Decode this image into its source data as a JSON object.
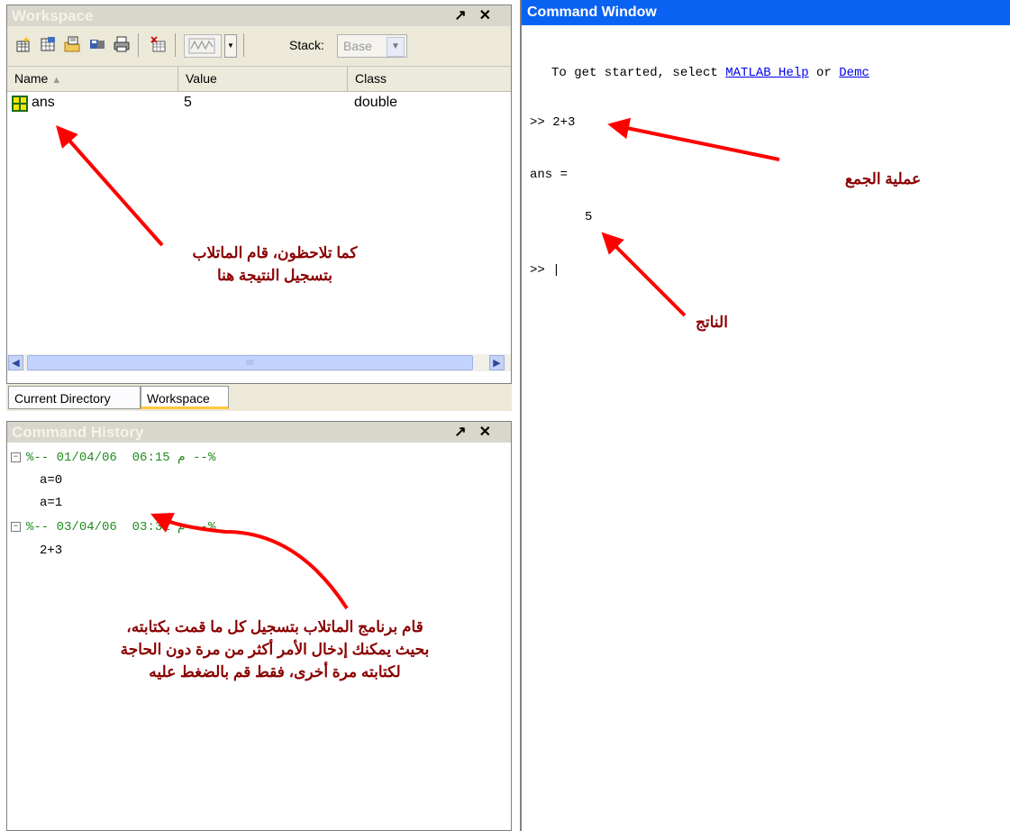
{
  "workspace": {
    "title": "Workspace",
    "undock_label": "↗",
    "close_label": "✕",
    "toolbar": {
      "stack_label": "Stack:",
      "stack_value": "Base",
      "icons": [
        "new-variable-icon",
        "open-variable-icon",
        "import-data-icon",
        "save-icon",
        "print-icon",
        "delete-icon",
        "plot-icon"
      ]
    },
    "columns": [
      "Name",
      "Value",
      "Class"
    ],
    "sort_indicator": "▲",
    "rows": [
      {
        "name": "ans",
        "value": "5",
        "class": "double"
      }
    ],
    "scroll_grip": "IIII"
  },
  "tabs": [
    {
      "label": "Current Directory",
      "active": false
    },
    {
      "label": "Workspace",
      "active": true
    }
  ],
  "history": {
    "title": "Command History",
    "undock_label": "↗",
    "close_label": "✕",
    "sessions": [
      {
        "header": "%-- م 06:15  01/04/06 --%",
        "commands": [
          "a=0",
          "a=1"
        ]
      },
      {
        "header": "%-- م 03:31  03/04/06 --%",
        "commands": [
          "2+3"
        ]
      }
    ]
  },
  "command_window": {
    "title": "Command Window",
    "intro_prefix": "To get started, select ",
    "help_link": "MATLAB Help",
    "intro_middle": " or ",
    "demos_link": "Demc",
    "lines": {
      "input": ">> 2+3",
      "ans": "ans =",
      "result": "5",
      "prompt": ">> |"
    }
  },
  "annotations": {
    "workspace_note": [
      "كما تلاحظون، قام الماتلاب",
      "بتسجيل النتيجة هنا"
    ],
    "history_note": [
      "قام برنامج الماتلاب بتسجيل كل ما قمت بكتابته،",
      "بحيث يمكنك إدخال الأمر أكثر من مرة دون الحاجة",
      "لكتابته مرة  أخرى، فقط قم بالضغط عليه"
    ],
    "sum_note": "عملية الجمع",
    "result_note": "الناتج"
  },
  "colors": {
    "command_title_bg": "#0a62f2",
    "annotation_text": "#8b0000",
    "arrow": "#ff0000",
    "history_header": "#228b22"
  }
}
